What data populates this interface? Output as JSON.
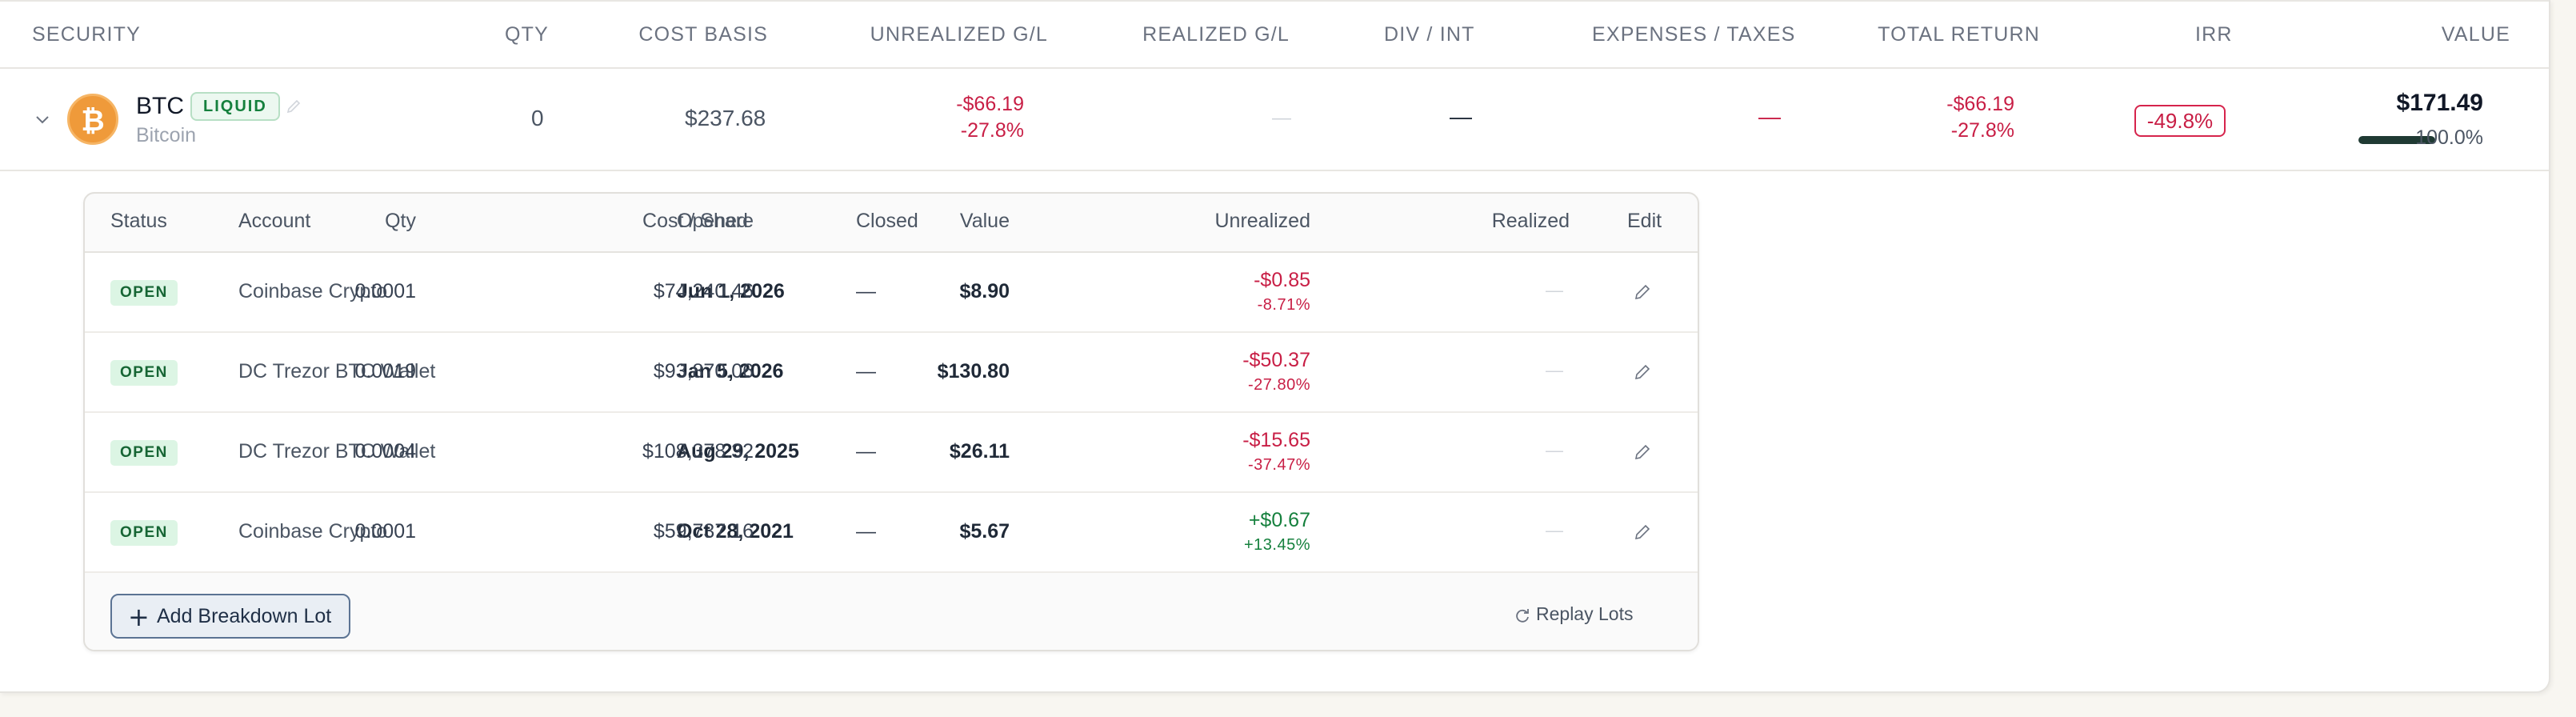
{
  "columns": {
    "security": "SECURITY",
    "qty": "QTY",
    "cost_basis": "COST BASIS",
    "unrealized": "UNREALIZED G/L",
    "realized": "REALIZED G/L",
    "div_int": "DIV / INT",
    "expenses": "EXPENSES / TAXES",
    "total_return": "TOTAL RETURN",
    "irr": "IRR",
    "value": "VALUE"
  },
  "security": {
    "ticker": "BTC",
    "name": "Bitcoin",
    "badge": "LIQUID",
    "coin_glyph": "₿",
    "qty": "0",
    "cost_basis": "$237.68",
    "unrealized_amount": "-$66.19",
    "unrealized_pct": "-27.8%",
    "realized": "—",
    "div_int": "—",
    "expenses": "—",
    "total_return_amount": "-$66.19",
    "total_return_pct": "-27.8%",
    "irr": "-49.8%",
    "value": "$171.49",
    "allocation_pct": "100.0%",
    "allocation_fraction": 1.0
  },
  "lots_table": {
    "headers": {
      "status": "Status",
      "account": "Account",
      "opened": "Opened",
      "closed": "Closed",
      "qty": "Qty",
      "cost_share": "Cost / Share",
      "value": "Value",
      "unrealized": "Unrealized",
      "realized": "Realized",
      "edit": "Edit"
    },
    "rows": [
      {
        "status": "OPEN",
        "account": "Coinbase Crypto",
        "opened": "Jun 1, 2026",
        "closed": "—",
        "qty": "0.0001",
        "cost_share": "$74,240.46",
        "value": "$8.90",
        "unrealized": "-$0.85",
        "unrealized_pct": "-8.71%",
        "realized": "—"
      },
      {
        "status": "OPEN",
        "account": "DC Trezor BTC Wallet",
        "opened": "Jan 5, 2026",
        "closed": "—",
        "qty": "0.0019",
        "cost_share": "$93,870.06",
        "value": "$130.80",
        "unrealized": "-$50.37",
        "unrealized_pct": "-27.80%",
        "realized": "—"
      },
      {
        "status": "OPEN",
        "account": "DC Trezor BTC Wallet",
        "opened": "Aug 29, 2025",
        "closed": "—",
        "qty": "0.0004",
        "cost_share": "$108,378.32",
        "value": "$26.11",
        "unrealized": "-$15.65",
        "unrealized_pct": "-37.47%",
        "realized": "—"
      },
      {
        "status": "OPEN",
        "account": "Coinbase Crypto",
        "opened": "Oct 28, 2021",
        "closed": "—",
        "qty": "0.0001",
        "cost_share": "$59,737.16",
        "value": "$5.67",
        "unrealized": "+$0.67",
        "unrealized_pct": "+13.45%",
        "realized": "—"
      }
    ]
  },
  "footer": {
    "add_button": "Add Breakdown Lot",
    "replay_button": "Replay Lots"
  },
  "colors": {
    "negative": "#c81e45",
    "positive": "#15803d",
    "coin": "#ef9a3a",
    "accent": "#5b7393"
  }
}
